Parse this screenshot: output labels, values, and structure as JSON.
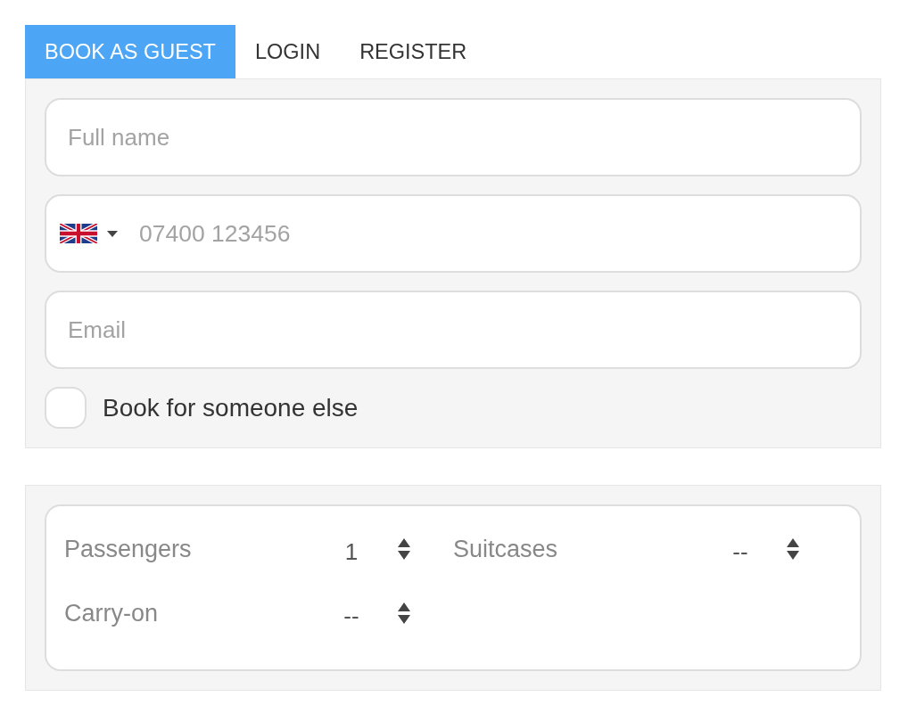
{
  "tabs": [
    {
      "label": "BOOK AS GUEST",
      "selected": true
    },
    {
      "label": "LOGIN",
      "selected": false
    },
    {
      "label": "REGISTER",
      "selected": false
    }
  ],
  "contact_form": {
    "fields": [
      {
        "kind": "text",
        "placeholder": "Full name"
      },
      {
        "kind": "phone",
        "placeholder": "07400 123456"
      },
      {
        "kind": "text",
        "placeholder": "Email"
      }
    ],
    "book_for_someone_else": {
      "label": "Book for someone else",
      "checked": false
    }
  },
  "luggage": {
    "counters": [
      {
        "label": "Passengers",
        "value": "1"
      },
      {
        "label": "Suitcases",
        "value": "--"
      },
      {
        "label": "Carry-on",
        "value": "--"
      }
    ]
  }
}
